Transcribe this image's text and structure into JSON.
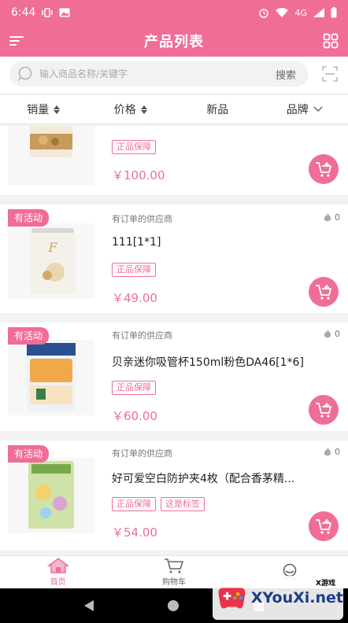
{
  "status_bar": {
    "time": "6:44",
    "network": "4G"
  },
  "header": {
    "title": "产品列表"
  },
  "search": {
    "placeholder": "输入商品名称/关键字",
    "button_label": "搜索"
  },
  "sort_bar": {
    "items": [
      {
        "label": "销量"
      },
      {
        "label": "价格"
      },
      {
        "label": "新品"
      },
      {
        "label": "品牌"
      }
    ]
  },
  "products": [
    {
      "badge": "",
      "supplier": "",
      "hot_count": "",
      "title": "",
      "tags": [
        "正品保障"
      ],
      "price": "￥100.00"
    },
    {
      "badge": "有活动",
      "supplier": "有订单的供应商",
      "hot_count": "0",
      "title": "111[1*1]",
      "tags": [
        "正品保障"
      ],
      "price": "￥49.00"
    },
    {
      "badge": "有活动",
      "supplier": "有订单的供应商",
      "hot_count": "0",
      "title": "贝亲迷你吸管杯150ml粉色DA46[1*6]",
      "tags": [
        "正品保障"
      ],
      "price": "￥60.00"
    },
    {
      "badge": "有活动",
      "supplier": "有订单的供应商",
      "hot_count": "0",
      "title": "好可爱空白防护夹4枚（配合香茅精...",
      "tags": [
        "正品保障",
        "这是标签"
      ],
      "price": "￥54.00"
    }
  ],
  "tabbar": {
    "items": [
      {
        "label": "首页",
        "icon": "home-icon"
      },
      {
        "label": "购物车",
        "icon": "cart-icon"
      },
      {
        "label": "",
        "icon": "user-icon"
      }
    ]
  },
  "watermark": {
    "text": "XYouXi.net",
    "small": "X游戏"
  },
  "colors": {
    "accent": "#f06d96"
  }
}
